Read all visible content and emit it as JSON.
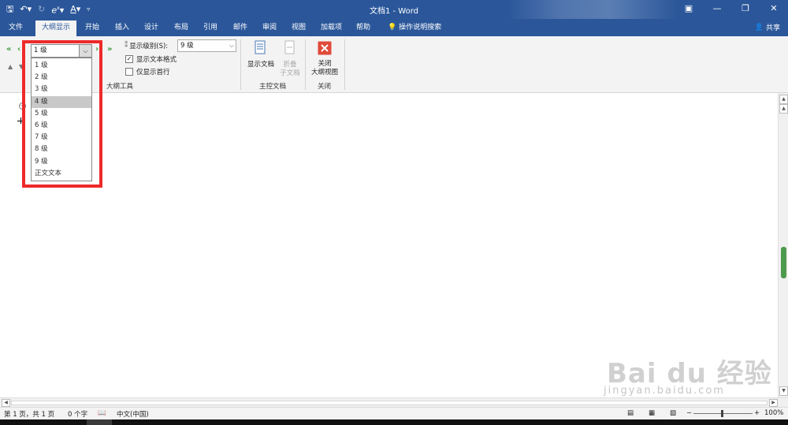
{
  "window": {
    "title": "文档1 - Word"
  },
  "tabs": [
    {
      "label": "文件"
    },
    {
      "label": "大纲显示"
    },
    {
      "label": "开始"
    },
    {
      "label": "插入"
    },
    {
      "label": "设计"
    },
    {
      "label": "布局"
    },
    {
      "label": "引用"
    },
    {
      "label": "邮件"
    },
    {
      "label": "审阅"
    },
    {
      "label": "视图"
    },
    {
      "label": "加载项"
    },
    {
      "label": "帮助"
    },
    {
      "label": "操作说明搜索"
    }
  ],
  "share_label": "共享",
  "ribbon": {
    "outline_level_value": "1 级",
    "show_level_label": "显示级别(S):",
    "show_level_value": "9 级",
    "show_text_formatting": "显示文本格式",
    "show_first_line_only": "仅显示首行",
    "outline_tools_label": "大纲工具",
    "show_document": "显示文档",
    "collapse_subdocs": [
      "折叠",
      "子文档"
    ],
    "master_document_label": "主控文档",
    "close_outline_view": [
      "关闭",
      "大纲视图"
    ],
    "close_group_label": "关闭"
  },
  "level_options": [
    "1 级",
    "2 级",
    "3 级",
    "4 级",
    "5 级",
    "6 级",
    "7 级",
    "8 级",
    "9 级",
    "正文文本"
  ],
  "level_selected_index": 3,
  "status": {
    "page": "第 1 页，共 1 页",
    "words": "0 个字",
    "language": "中文(中国)",
    "zoom": "100%"
  },
  "watermark": {
    "brand": "Bai du 经验",
    "url": "jingyan.baidu.com"
  }
}
